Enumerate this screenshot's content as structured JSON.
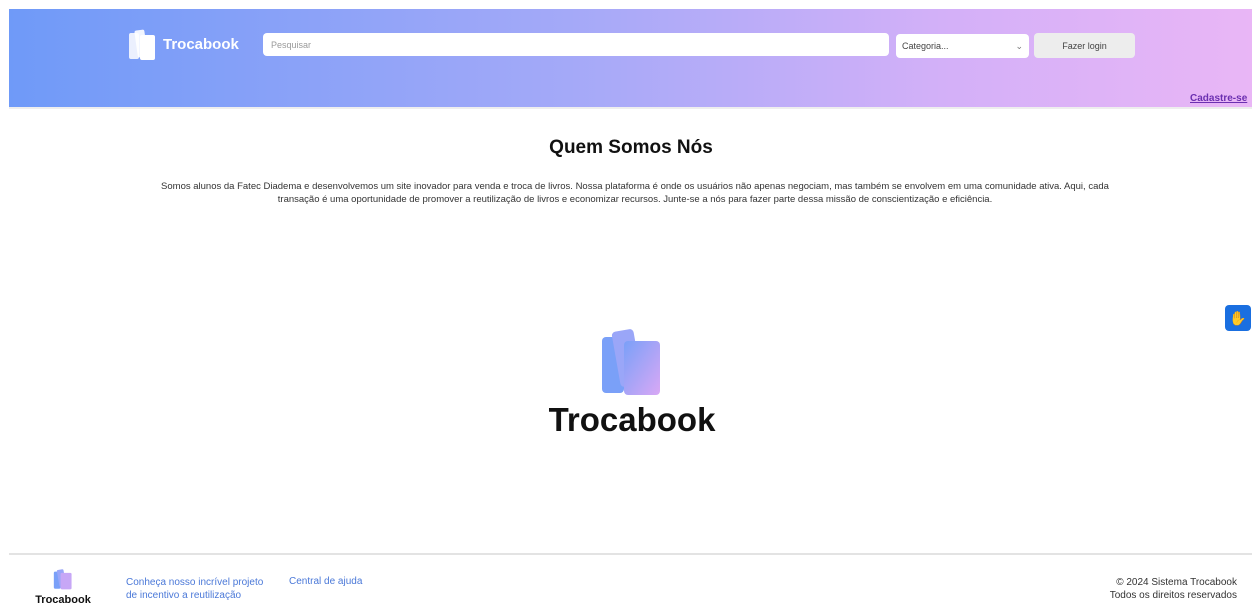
{
  "header": {
    "brand": "Trocabook",
    "search_placeholder": "Pesquisar",
    "category_selected": "Categoria...",
    "login_label": "Fazer login",
    "signup_label": "Cadastre-se"
  },
  "main": {
    "title": "Quem Somos Nós",
    "about_text": "Somos alunos da Fatec Diadema e desenvolvemos um site inovador para venda e troca de livros. Nossa plataforma é onde os usuários não apenas negociam, mas também se envolvem em uma comunidade ativa. Aqui, cada transação é uma oportunidade de promover a reutilização de livros e economizar recursos. Junte-se a nós para fazer parte dessa missão de conscientização e eficiência.",
    "logo_text": "Trocabook"
  },
  "footer": {
    "brand": "Trocabook",
    "project_link_line1": "Conheça nosso incrível projeto",
    "project_link_line2": "de incentivo a reutilização",
    "help_link": "Central de ajuda",
    "copyright": "© 2024 Sistema Trocabook",
    "rights": "Todos os direitos reservados"
  },
  "icons": {
    "brand_logo": "books-icon",
    "category_chevron": "chevron-down-icon",
    "accessibility": "sign-language-hand-icon"
  },
  "colors": {
    "header_gradient_start": "#6f9af8",
    "header_gradient_end": "#e9b6f6",
    "signup_link": "#6b2fb0",
    "footer_link": "#4a78d8",
    "accessibility_button": "#1a6fe0"
  }
}
